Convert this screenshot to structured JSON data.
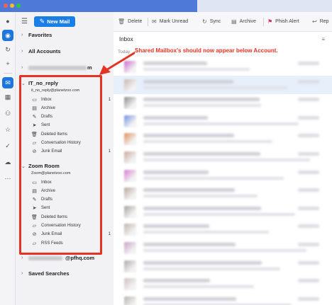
{
  "toolbar": {
    "new_mail": "New Mail",
    "delete": "Delete",
    "mark_unread": "Mark Unread",
    "sync": "Sync",
    "archive": "Archive",
    "phish_alert": "Phish Alert",
    "reply": "Rep"
  },
  "folders": {
    "favorites": "Favorites",
    "all_accounts": "All Accounts",
    "account1_suffix": "m",
    "account2_suffix": "@pfhq.com",
    "saved_searches": "Saved Searches",
    "it_no_reply": {
      "name": "IT_no_reply",
      "email": "it_no_reply@planetzoo.com",
      "items": [
        {
          "label": "Inbox",
          "icon": "inbox-icon",
          "count": "1"
        },
        {
          "label": "Archive",
          "icon": "archive-icon",
          "count": ""
        },
        {
          "label": "Drafts",
          "icon": "drafts-icon",
          "count": ""
        },
        {
          "label": "Sent",
          "icon": "sent-icon",
          "count": ""
        },
        {
          "label": "Deleted Items",
          "icon": "trash-icon",
          "count": ""
        },
        {
          "label": "Conversation History",
          "icon": "folder-icon",
          "count": ""
        },
        {
          "label": "Junk Email",
          "icon": "junk-icon",
          "count": "1"
        }
      ]
    },
    "zoom_room": {
      "name": "Zoom Room",
      "email": "Zoom@planetzoo.com",
      "items": [
        {
          "label": "Inbox",
          "icon": "inbox-icon",
          "count": ""
        },
        {
          "label": "Archive",
          "icon": "archive-icon",
          "count": ""
        },
        {
          "label": "Drafts",
          "icon": "drafts-icon",
          "count": ""
        },
        {
          "label": "Sent",
          "icon": "sent-icon",
          "count": ""
        },
        {
          "label": "Deleted Items",
          "icon": "trash-icon",
          "count": ""
        },
        {
          "label": "Conversation History",
          "icon": "folder-icon",
          "count": ""
        },
        {
          "label": "Junk Email",
          "icon": "junk-icon",
          "count": "1"
        },
        {
          "label": "RSS Feeds",
          "icon": "folder-icon",
          "count": ""
        }
      ]
    }
  },
  "message_list": {
    "title": "Inbox",
    "group_label": "Today"
  },
  "annotation": {
    "text": "Shared Mailbox's should now appear below Account.",
    "color": "#e53323"
  },
  "colors": {
    "accent": "#1a7ee6",
    "highlight": "#e53323",
    "titlebar": "#4f79d8"
  }
}
